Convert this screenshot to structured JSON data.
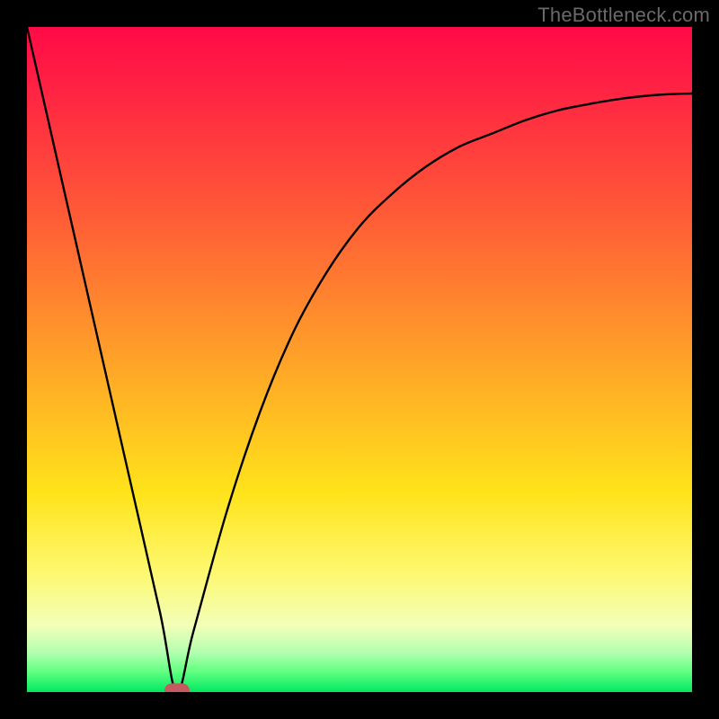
{
  "watermark": "TheBottleneck.com",
  "chart_data": {
    "type": "line",
    "title": "",
    "xlabel": "",
    "ylabel": "",
    "xlim": [
      0,
      100
    ],
    "ylim": [
      0,
      100
    ],
    "grid": false,
    "legend": false,
    "series": [
      {
        "name": "curve",
        "x": [
          0,
          5,
          10,
          15,
          20,
          22.5,
          25,
          30,
          35,
          40,
          45,
          50,
          55,
          60,
          65,
          70,
          75,
          80,
          85,
          90,
          95,
          100
        ],
        "values": [
          100,
          78,
          56,
          34,
          12,
          0,
          9,
          27,
          42,
          54,
          63,
          70,
          75,
          79,
          82,
          84,
          86,
          87.5,
          88.5,
          89.3,
          89.8,
          90
        ]
      }
    ],
    "marker": {
      "x": 22.5,
      "y": 0
    },
    "background": "red-yellow-green vertical gradient"
  }
}
